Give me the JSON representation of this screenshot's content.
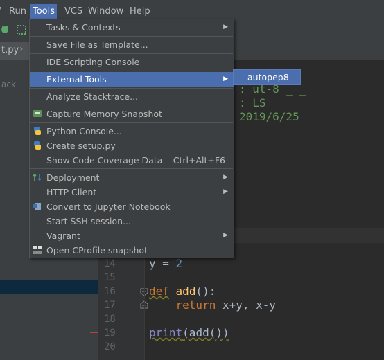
{
  "menubar": {
    "items": [
      {
        "label": "Run",
        "active": false
      },
      {
        "label": "Tools",
        "active": true
      },
      {
        "label": "VCS",
        "active": false
      },
      {
        "label": "Window",
        "active": false
      },
      {
        "label": "Help",
        "active": false
      }
    ]
  },
  "tab": {
    "label": "t.py"
  },
  "leftpanel": {
    "text": "ack"
  },
  "tools_menu": {
    "items": [
      {
        "label": "Tasks & Contexts",
        "submenu": true
      },
      {
        "label": "Save File as Template..."
      },
      {
        "label": "IDE Scripting Console"
      },
      {
        "label": "External Tools",
        "submenu": true,
        "highlighted": true
      },
      {
        "label": "Analyze Stacktrace..."
      },
      {
        "label": "Capture Memory Snapshot",
        "icon": "memory-snapshot-icon"
      },
      {
        "label": "Python Console...",
        "icon": "python-icon"
      },
      {
        "label": "Create setup.py",
        "icon": "python-setup-icon"
      },
      {
        "label": "Show Code Coverage Data",
        "shortcut": "Ctrl+Alt+F6"
      },
      {
        "label": "Deployment",
        "submenu": true,
        "icon": "deployment-icon"
      },
      {
        "label": "HTTP Client",
        "submenu": true
      },
      {
        "label": "Convert to Jupyter Notebook",
        "icon": "jupyter-icon"
      },
      {
        "label": "Start SSH session..."
      },
      {
        "label": "Vagrant",
        "submenu": true
      },
      {
        "label": "Open CProfile snapshot",
        "icon": "cprofile-icon"
      }
    ]
  },
  "submenu": {
    "items": [
      {
        "label": "autopep8"
      }
    ]
  },
  "header_comment": {
    "line1": ": ut-8 _ _",
    "line2": ": LS",
    "line3": "2019/6/25"
  },
  "editor": {
    "line_numbers": [
      "14",
      "15",
      "16",
      "17",
      "18",
      "19",
      "20"
    ],
    "lines": {
      "l14_var": "y",
      "l14_op": " = ",
      "l14_num": "2",
      "l16_kw": "def",
      "l16_fn": "add",
      "l16_rest": "():",
      "l17_kw": "return",
      "l17_rest": " x+y, x-y",
      "l19_bi": "print",
      "l19_rest": "(add())"
    }
  },
  "colors": {
    "menu_bg": "#3c3f41",
    "highlight": "#4b6eaf",
    "editor_bg": "#2b2b2b",
    "keyword": "#cc7832",
    "function": "#ffc66d"
  }
}
